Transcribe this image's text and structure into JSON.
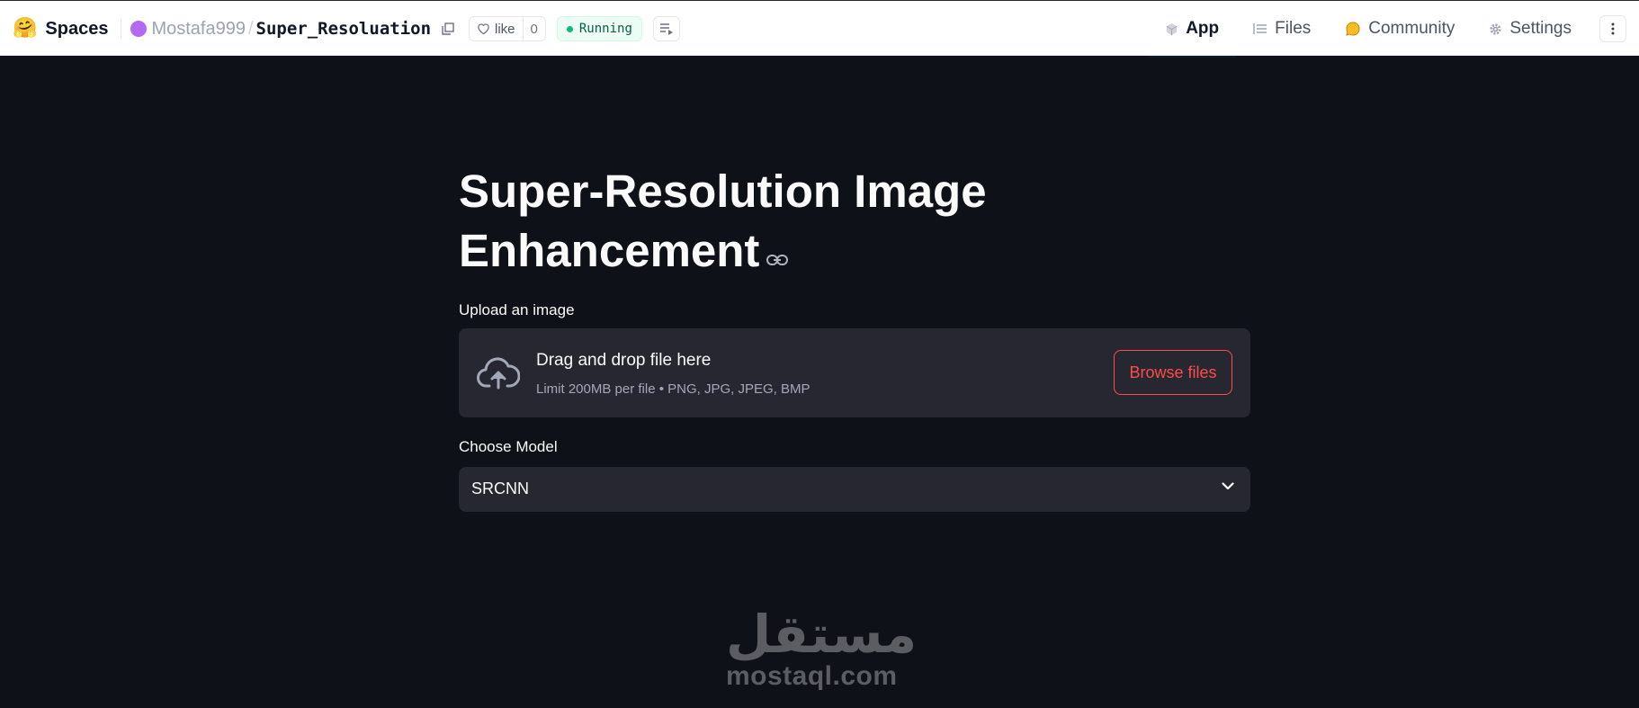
{
  "header": {
    "brand_emoji": "🤗",
    "brand_label": "Spaces",
    "owner": "Mostafa999",
    "separator": "/",
    "repo_name": "Super_Resoluation",
    "like_label": "like",
    "like_count": "0",
    "status": "Running",
    "tabs": [
      {
        "label": "App",
        "icon": "app-cube-icon",
        "active": true
      },
      {
        "label": "Files",
        "icon": "files-icon",
        "active": false
      },
      {
        "label": "Community",
        "icon": "community-icon",
        "active": false
      },
      {
        "label": "Settings",
        "icon": "gear-icon",
        "active": false
      }
    ]
  },
  "app": {
    "title": "Super-Resolution Image Enhancement",
    "upload_label": "Upload an image",
    "dropzone_title": "Drag and drop file here",
    "dropzone_limits": "Limit 200MB per file • PNG, JPG, JPEG, BMP",
    "browse_label": "Browse files",
    "model_label": "Choose Model",
    "model_selected": "SRCNN"
  },
  "watermark": {
    "arabic": "مستقل",
    "latin": "mostaql.com"
  },
  "colors": {
    "background": "#0e1117",
    "surface": "#262730",
    "accent": "#ff4b4b",
    "status_green": "#10b981",
    "owner_avatar": "#b46af0"
  }
}
